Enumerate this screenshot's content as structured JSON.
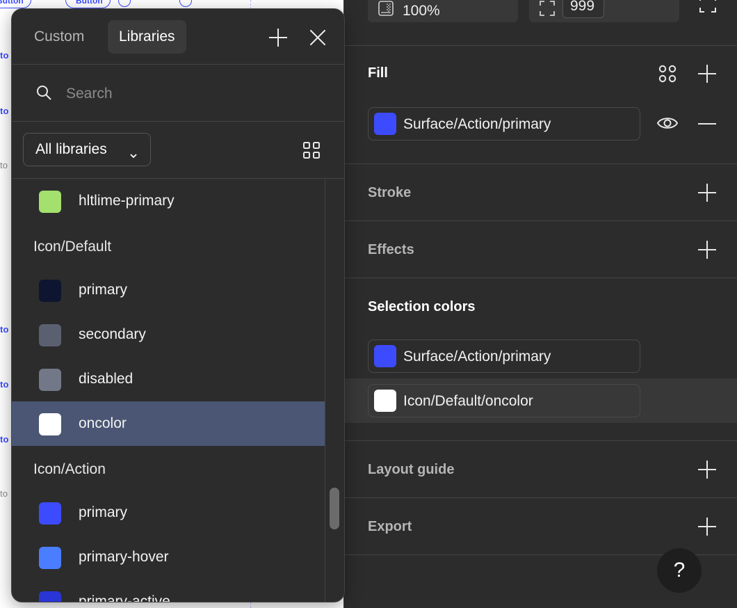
{
  "canvas": {
    "top_button_label": "Button",
    "side_fragment": "to"
  },
  "panel": {
    "opacity_value": "100%",
    "radius_value": "999",
    "fill": {
      "title": "Fill",
      "swatch": {
        "label": "Surface/Action/primary",
        "color": "#3d4bff"
      }
    },
    "stroke": {
      "title": "Stroke"
    },
    "effects": {
      "title": "Effects"
    },
    "selection_colors": {
      "title": "Selection colors",
      "items": [
        {
          "label": "Surface/Action/primary",
          "color": "#3d4bff"
        },
        {
          "label": "Icon/Default/oncolor",
          "color": "#ffffff"
        }
      ]
    },
    "layout_guide": {
      "title": "Layout guide"
    },
    "export": {
      "title": "Export"
    },
    "help_label": "?"
  },
  "popup": {
    "tabs": [
      "Custom",
      "Libraries"
    ],
    "active_tab": "Libraries",
    "search_placeholder": "Search",
    "filter_label": "All libraries",
    "items": [
      {
        "type": "color",
        "label": "hltlime-primary",
        "color": "#a3e06e"
      },
      {
        "type": "group",
        "label": "Icon/Default"
      },
      {
        "type": "color",
        "label": "primary",
        "color": "#0e1530"
      },
      {
        "type": "color",
        "label": "secondary",
        "color": "#5b6071"
      },
      {
        "type": "color",
        "label": "disabled",
        "color": "#737888"
      },
      {
        "type": "color",
        "label": "oncolor",
        "color": "#ffffff",
        "selected": true
      },
      {
        "type": "group",
        "label": "Icon/Action"
      },
      {
        "type": "color",
        "label": "primary",
        "color": "#3d4bff"
      },
      {
        "type": "color",
        "label": "primary-hover",
        "color": "#4a7dff"
      },
      {
        "type": "color",
        "label": "primary-active",
        "color": "#2a35d6"
      }
    ]
  }
}
